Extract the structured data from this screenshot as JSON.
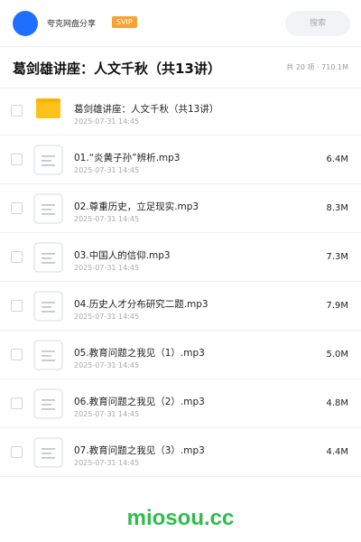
{
  "header": {
    "brand": "夸克网盘分享",
    "badge": "SVIP",
    "search_placeholder": "搜索"
  },
  "titlebar": {
    "title": "葛剑雄讲座：人文千秋（共13讲）",
    "meta": "共 20 项 · 710.1M"
  },
  "files": [
    {
      "name": "葛剑雄讲座：人文千秋（共13讲）",
      "date": "2025-07-31 14:45",
      "size": "",
      "type": "folder"
    },
    {
      "name": "01.“炎黄子孙”辨析.mp3",
      "date": "2025-07-31 14:45",
      "size": "6.4M",
      "type": "audio"
    },
    {
      "name": "02.尊重历史，立足现实.mp3",
      "date": "2025-07-31 14:45",
      "size": "8.3M",
      "type": "audio"
    },
    {
      "name": "03.中国人的信仰.mp3",
      "date": "2025-07-31 14:45",
      "size": "7.3M",
      "type": "audio"
    },
    {
      "name": "04.历史人才分布研究二题.mp3",
      "date": "2025-07-31 14:45",
      "size": "7.9M",
      "type": "audio"
    },
    {
      "name": "05.教育问题之我见（1）.mp3",
      "date": "2025-07-31 14:45",
      "size": "5.0M",
      "type": "audio"
    },
    {
      "name": "06.教育问题之我见（2）.mp3",
      "date": "2025-07-31 14:45",
      "size": "4.8M",
      "type": "audio"
    },
    {
      "name": "07.教育问题之我见（3）.mp3",
      "date": "2025-07-31 14:45",
      "size": "4.4M",
      "type": "audio"
    }
  ],
  "watermark": "miosou.cc",
  "colors": {
    "folder": "#ffc21a",
    "folder_tab": "#ffb000",
    "badge": "#f7a234",
    "avatar": "#1f6fff",
    "watermark": "#2fbd4e"
  }
}
